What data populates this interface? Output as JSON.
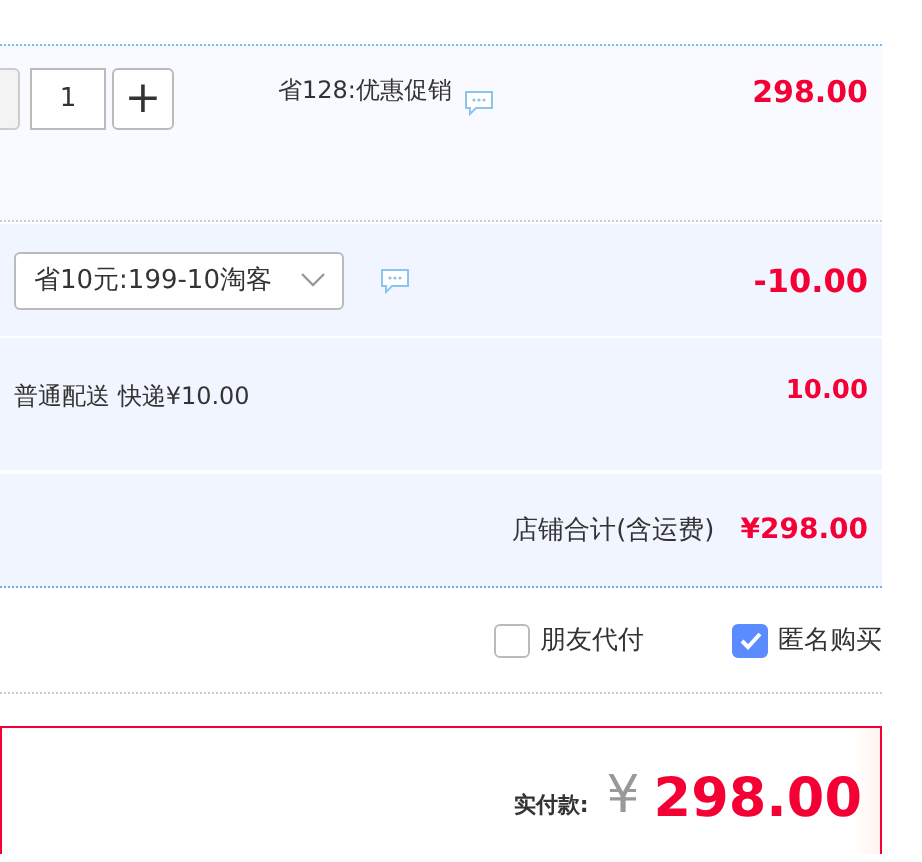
{
  "item": {
    "quantity": "1",
    "increment": "+",
    "promotion": "省128:优惠促销",
    "price": "298.00"
  },
  "coupon": {
    "value": "省10元:199-10淘客",
    "amount": "-10.00"
  },
  "shipping": {
    "label": "普通配送 快递¥10.00",
    "amount": "10.00"
  },
  "shop_total": {
    "label": "店铺合计(含运费)",
    "amount": "¥298.00"
  },
  "options": [
    {
      "label": "朋友代付",
      "checked": false
    },
    {
      "label": "匿名购买",
      "checked": true
    }
  ],
  "payment": {
    "label": "实付款:",
    "currency": "¥",
    "amount": "298.00"
  }
}
